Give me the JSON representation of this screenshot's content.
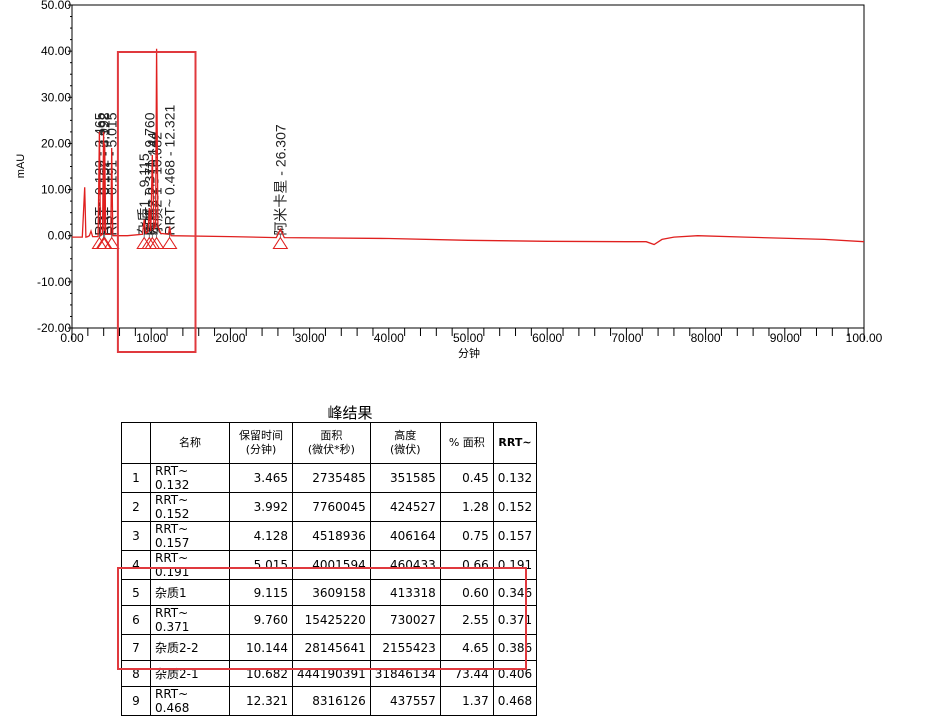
{
  "chart_data": {
    "type": "line",
    "xlabel": "分钟",
    "ylabel": "mAU",
    "xlim": [
      0,
      100
    ],
    "ylim": [
      -20,
      50
    ],
    "xticks": [
      "0.00",
      "10.00",
      "20.00",
      "30.00",
      "40.00",
      "50.00",
      "60.00",
      "70.00",
      "80.00",
      "90.00",
      "100.00"
    ],
    "yticks": [
      "-20.00",
      "-10.00",
      "0.00",
      "10.00",
      "20.00",
      "30.00",
      "40.00",
      "50.00"
    ],
    "line_color": "#e0201f",
    "highlight_color": "#e0393e",
    "highlight_x_range": [
      5.8,
      15.6
    ],
    "trace": [
      [
        0,
        -0.3
      ],
      [
        1.3,
        -0.3
      ],
      [
        1.6,
        10.5
      ],
      [
        1.75,
        -0.3
      ],
      [
        2.0,
        -0.2
      ],
      [
        2.2,
        0.0
      ],
      [
        2.4,
        1.0
      ],
      [
        2.6,
        -0.2
      ],
      [
        3.3,
        -0.2
      ],
      [
        3.465,
        22.5
      ],
      [
        3.6,
        0.0
      ],
      [
        3.85,
        0.3
      ],
      [
        3.992,
        22.5
      ],
      [
        4.05,
        1.0
      ],
      [
        4.128,
        20.0
      ],
      [
        4.25,
        0.3
      ],
      [
        4.9,
        0.3
      ],
      [
        5.015,
        19.0
      ],
      [
        5.15,
        0.0
      ],
      [
        7.0,
        0.0
      ],
      [
        8.9,
        0.3
      ],
      [
        9.115,
        3.5
      ],
      [
        9.3,
        0.5
      ],
      [
        9.6,
        0.8
      ],
      [
        9.76,
        6.0
      ],
      [
        9.95,
        1.0
      ],
      [
        10.144,
        17.5
      ],
      [
        10.35,
        1.5
      ],
      [
        10.55,
        2.0
      ],
      [
        10.682,
        40.5
      ],
      [
        10.85,
        2.0
      ],
      [
        11.2,
        0.5
      ],
      [
        12.2,
        0.3
      ],
      [
        12.321,
        2.0
      ],
      [
        12.5,
        0.0
      ],
      [
        20,
        -0.2
      ],
      [
        25.8,
        -0.4
      ],
      [
        26.307,
        1.4
      ],
      [
        26.8,
        -0.4
      ],
      [
        40,
        -0.6
      ],
      [
        50,
        -1.0
      ],
      [
        60,
        -1.2
      ],
      [
        70,
        -1.3
      ],
      [
        72.5,
        -1.3
      ],
      [
        73.5,
        -1.9
      ],
      [
        74.5,
        -0.8
      ],
      [
        76,
        -0.3
      ],
      [
        79,
        0.0
      ],
      [
        85,
        -0.3
      ],
      [
        95,
        -0.8
      ],
      [
        100,
        -1.3
      ]
    ],
    "peaks": [
      {
        "label": "RRT~ 0.132 - 3.465",
        "x": 3.465
      },
      {
        "label": "RRT~ 0.152 - 3.992",
        "x": 3.992
      },
      {
        "label": "RRT~ 0.157 - 4.128",
        "x": 4.128
      },
      {
        "label": "RRT~ 0.191 - 5.015",
        "x": 5.015
      },
      {
        "label": "杂质1 - 9.115",
        "x": 9.115
      },
      {
        "label": "RRT~ 0.371 - 9.760",
        "x": 9.76
      },
      {
        "label": "杂质2-2 - 10.144",
        "x": 10.144
      },
      {
        "label": "杂质2-1 - 10.682",
        "x": 10.682
      },
      {
        "label": "RRT~ 0.468 - 12.321",
        "x": 12.321
      },
      {
        "label": "阿米卡星 - 26.307",
        "x": 26.307
      }
    ]
  },
  "table": {
    "title": "峰结果",
    "headers": [
      {
        "line1": "",
        "line2": ""
      },
      {
        "line1": "名称",
        "line2": ""
      },
      {
        "line1": "保留时间",
        "line2": "(分钟)"
      },
      {
        "line1": "面积",
        "line2": "(微伏*秒)"
      },
      {
        "line1": "高度",
        "line2": "(微伏)"
      },
      {
        "line1": "% 面积",
        "line2": ""
      },
      {
        "line1": "RRT~",
        "line2": ""
      }
    ],
    "rows": [
      [
        "1",
        "RRT~ 0.132",
        "3.465",
        "2735485",
        "351585",
        "0.45",
        "0.132"
      ],
      [
        "2",
        "RRT~ 0.152",
        "3.992",
        "7760045",
        "424527",
        "1.28",
        "0.152"
      ],
      [
        "3",
        "RRT~ 0.157",
        "4.128",
        "4518936",
        "406164",
        "0.75",
        "0.157"
      ],
      [
        "4",
        "RRT~ 0.191",
        "5.015",
        "4001594",
        "460433",
        "0.66",
        "0.191"
      ],
      [
        "5",
        "杂质1",
        "9.115",
        "3609158",
        "413318",
        "0.60",
        "0.346"
      ],
      [
        "6",
        "RRT~ 0.371",
        "9.760",
        "15425220",
        "730027",
        "2.55",
        "0.371"
      ],
      [
        "7",
        "杂质2-2",
        "10.144",
        "28145641",
        "2155423",
        "4.65",
        "0.386"
      ],
      [
        "8",
        "杂质2-1",
        "10.682",
        "444190391",
        "31846134",
        "73.44",
        "0.406"
      ],
      [
        "9",
        "RRT~ 0.468",
        "12.321",
        "8316126",
        "437557",
        "1.37",
        "0.468"
      ]
    ],
    "highlight_rows": [
      "5",
      "6",
      "7",
      "8"
    ]
  }
}
